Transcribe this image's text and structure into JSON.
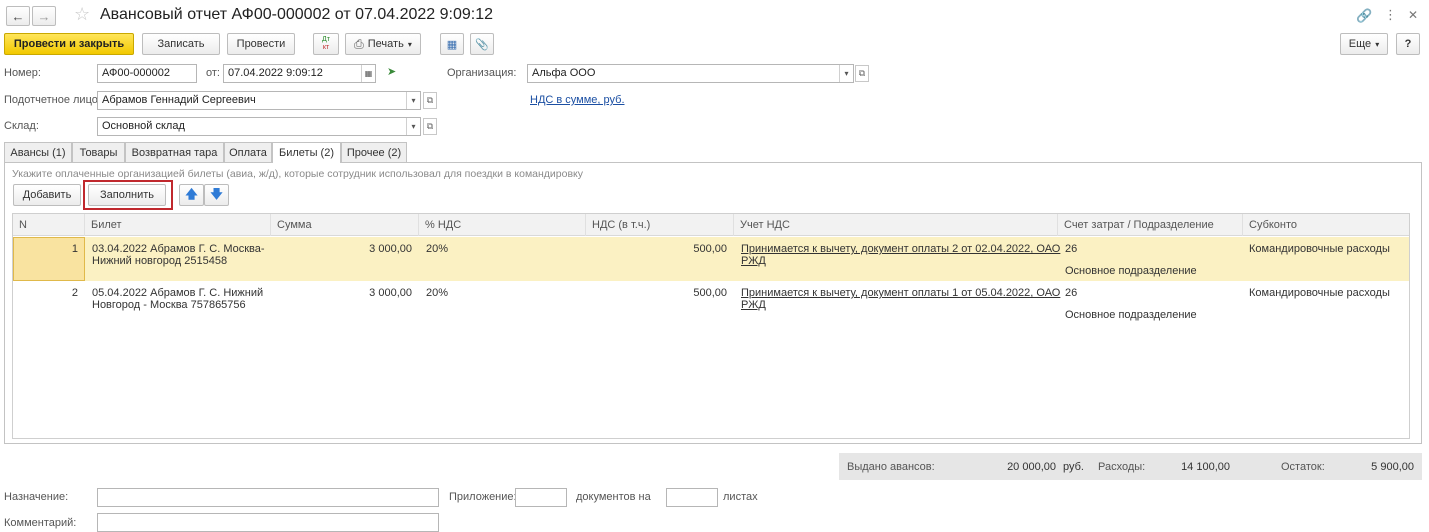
{
  "window": {
    "title": "Авансовый отчет АФ00-000002 от 07.04.2022 9:09:12"
  },
  "toolbar": {
    "post_close": "Провести и закрыть",
    "save": "Записать",
    "post": "Провести",
    "dtkt_top": "Дт",
    "dtkt_bottom": "кт",
    "print": "Печать",
    "more": "Еще",
    "help": "?"
  },
  "header": {
    "number_label": "Номер:",
    "number_value": "АФ00-000002",
    "date_label": "от:",
    "date_value": "07.04.2022  9:09:12",
    "org_label": "Организация:",
    "org_value": "Альфа ООО",
    "person_label": "Подотчетное лицо:",
    "person_value": "Абрамов Геннадий Сергеевич",
    "vat_link": "НДС в сумме, руб.",
    "warehouse_label": "Склад:",
    "warehouse_value": "Основной склад"
  },
  "tabs": [
    {
      "label": "Авансы (1)"
    },
    {
      "label": "Товары"
    },
    {
      "label": "Возвратная тара"
    },
    {
      "label": "Оплата"
    },
    {
      "label": "Билеты (2)"
    },
    {
      "label": "Прочее (2)"
    }
  ],
  "panel": {
    "hint": "Укажите оплаченные организацией билеты (авиа, ж/д), которые сотрудник использовал для поездки в командировку",
    "add": "Добавить",
    "fill": "Заполнить"
  },
  "table": {
    "columns": [
      "N",
      "Билет",
      "Сумма",
      "% НДС",
      "НДС (в т.ч.)",
      "Учет НДС",
      "Счет затрат / Подразделение",
      "Субконто"
    ],
    "rows": [
      {
        "n": "1",
        "ticket_line1": "03.04.2022 Абрамов Г. С. Москва-",
        "ticket_line2": "Нижний новгород 2515458",
        "sum": "3 000,00",
        "vat_rate": "20%",
        "vat_sum": "500,00",
        "vat_acc_line1": "Принимается к вычету, документ оплаты 2 от 02.04.2022, ОАО",
        "vat_acc_line2": "РЖД",
        "account": "26",
        "department": "Основное подразделение",
        "subconto": "Командировочные расходы"
      },
      {
        "n": "2",
        "ticket_line1": "05.04.2022 Абрамов Г. С. Нижний",
        "ticket_line2": "Новгород - Москва 757865756",
        "sum": "3 000,00",
        "vat_rate": "20%",
        "vat_sum": "500,00",
        "vat_acc_line1": "Принимается к вычету, документ оплаты 1 от 05.04.2022, ОАО",
        "vat_acc_line2": "РЖД",
        "account": "26",
        "department": "Основное подразделение",
        "subconto": "Командировочные расходы"
      }
    ]
  },
  "totals": {
    "advances_label": "Выдано авансов:",
    "advances_value": "20 000,00",
    "currency": "руб.",
    "expenses_label": "Расходы:",
    "expenses_value": "14 100,00",
    "balance_label": "Остаток:",
    "balance_value": "5 900,00"
  },
  "footer": {
    "purpose_label": "Назначение:",
    "attachment_label": "Приложение:",
    "docs_label": "документов на",
    "sheets_label": "листах",
    "comment_label": "Комментарий:"
  },
  "colors": {
    "primary_button": "#f2c900",
    "selected_row": "#fbf1c3",
    "highlight_box": "#c0282d",
    "link": "#1b4fa3",
    "arrow_blue": "#2f7bd6"
  }
}
